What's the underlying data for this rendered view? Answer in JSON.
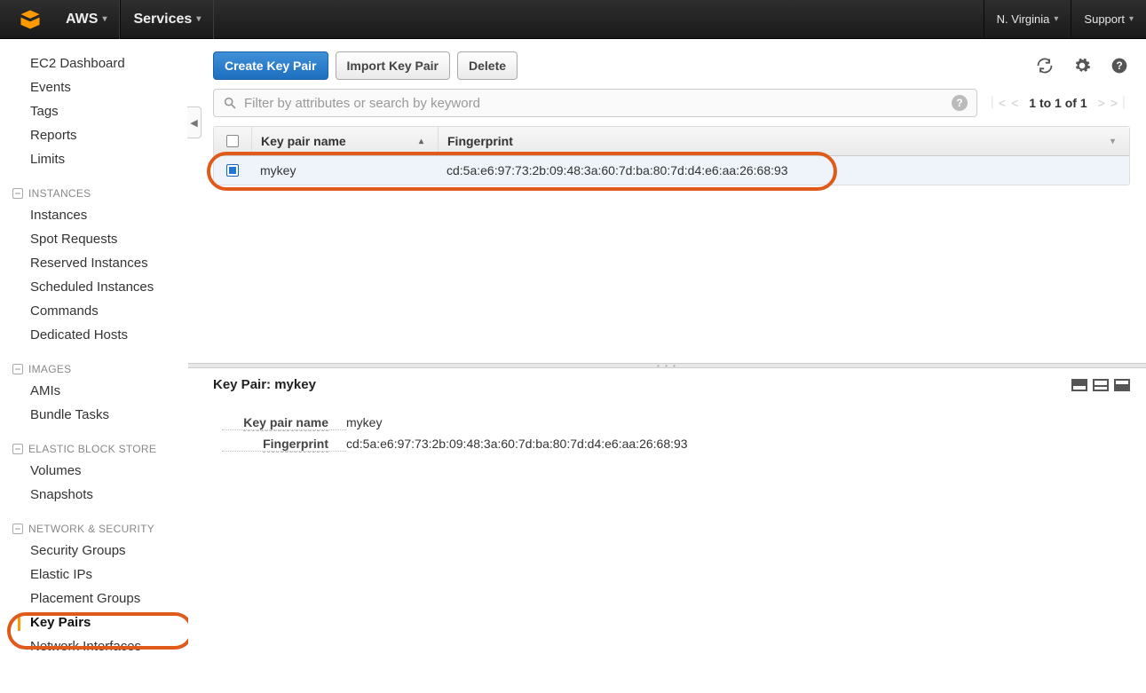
{
  "topnav": {
    "aws_label": "AWS",
    "services_label": "Services",
    "region": "N. Virginia",
    "support": "Support"
  },
  "sidebar": {
    "top": [
      "EC2 Dashboard",
      "Events",
      "Tags",
      "Reports",
      "Limits"
    ],
    "sections": [
      {
        "title": "INSTANCES",
        "items": [
          "Instances",
          "Spot Requests",
          "Reserved Instances",
          "Scheduled Instances",
          "Commands",
          "Dedicated Hosts"
        ]
      },
      {
        "title": "IMAGES",
        "items": [
          "AMIs",
          "Bundle Tasks"
        ]
      },
      {
        "title": "ELASTIC BLOCK STORE",
        "items": [
          "Volumes",
          "Snapshots"
        ]
      },
      {
        "title": "NETWORK & SECURITY",
        "items": [
          "Security Groups",
          "Elastic IPs",
          "Placement Groups",
          "Key Pairs",
          "Network Interfaces"
        ],
        "active": "Key Pairs"
      }
    ]
  },
  "toolbar": {
    "create": "Create Key Pair",
    "import": "Import Key Pair",
    "delete": "Delete"
  },
  "filter": {
    "placeholder": "Filter by attributes or search by keyword"
  },
  "pager": {
    "text": "1 to 1 of 1"
  },
  "table": {
    "headers": {
      "name": "Key pair name",
      "fingerprint": "Fingerprint"
    },
    "rows": [
      {
        "name": "mykey",
        "fingerprint": "cd:5a:e6:97:73:2b:09:48:3a:60:7d:ba:80:7d:d4:e6:aa:26:68:93",
        "checked": true
      }
    ]
  },
  "detail": {
    "title_prefix": "Key Pair: ",
    "title_value": "mykey",
    "fields": {
      "name_label": "Key pair name",
      "name_value": "mykey",
      "fp_label": "Fingerprint",
      "fp_value": "cd:5a:e6:97:73:2b:09:48:3a:60:7d:ba:80:7d:d4:e6:aa:26:68:93"
    }
  }
}
